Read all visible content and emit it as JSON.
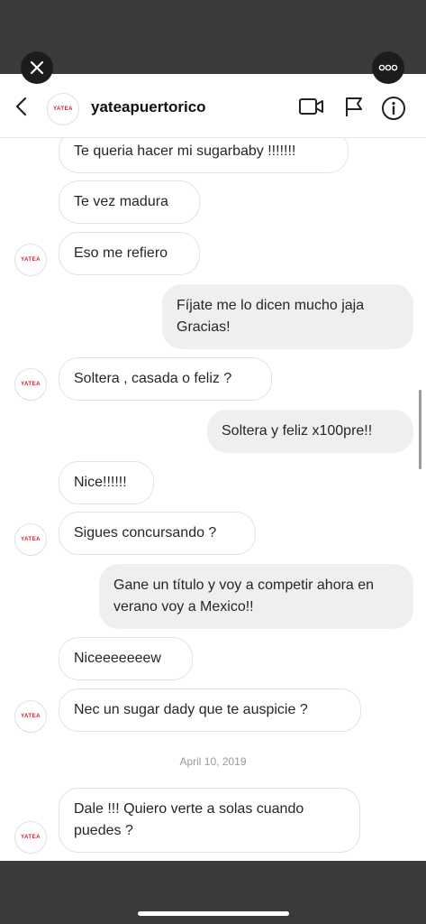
{
  "header": {
    "username": "yateapuertorico",
    "avatar_text": "YATEA"
  },
  "messages": {
    "m1": "Te queria hacer mi sugarbaby !!!!!!!",
    "m2": "Te vez madura",
    "m3": "Eso me refiero",
    "m4": "Fíjate me lo dicen mucho jaja Gracias!",
    "m5": "Soltera , casada o feliz ?",
    "m6": "Soltera y feliz x100pre!!",
    "m7": "Nice!!!!!!",
    "m8": "Sigues concursando ?",
    "m9": "Gane un título y voy a competir ahora en verano voy a Mexico!!",
    "m10": "Niceeeeeeew",
    "m11": "Nec un sugar dady que te auspicie ?",
    "date_divider": "April 10, 2019",
    "m12": "Dale !!! Quiero verte a solas cuando puedes ?"
  },
  "icons": {
    "close": "close-icon",
    "more": "more-icon",
    "back": "chevron-left-icon",
    "video": "video-camera-icon",
    "flag": "flag-icon",
    "info": "info-icon"
  },
  "colors": {
    "brand_red": "#c3262e",
    "incoming_bubble": "#ffffff",
    "outgoing_bubble": "#efefef",
    "chrome_dark": "#3a3a3a"
  }
}
